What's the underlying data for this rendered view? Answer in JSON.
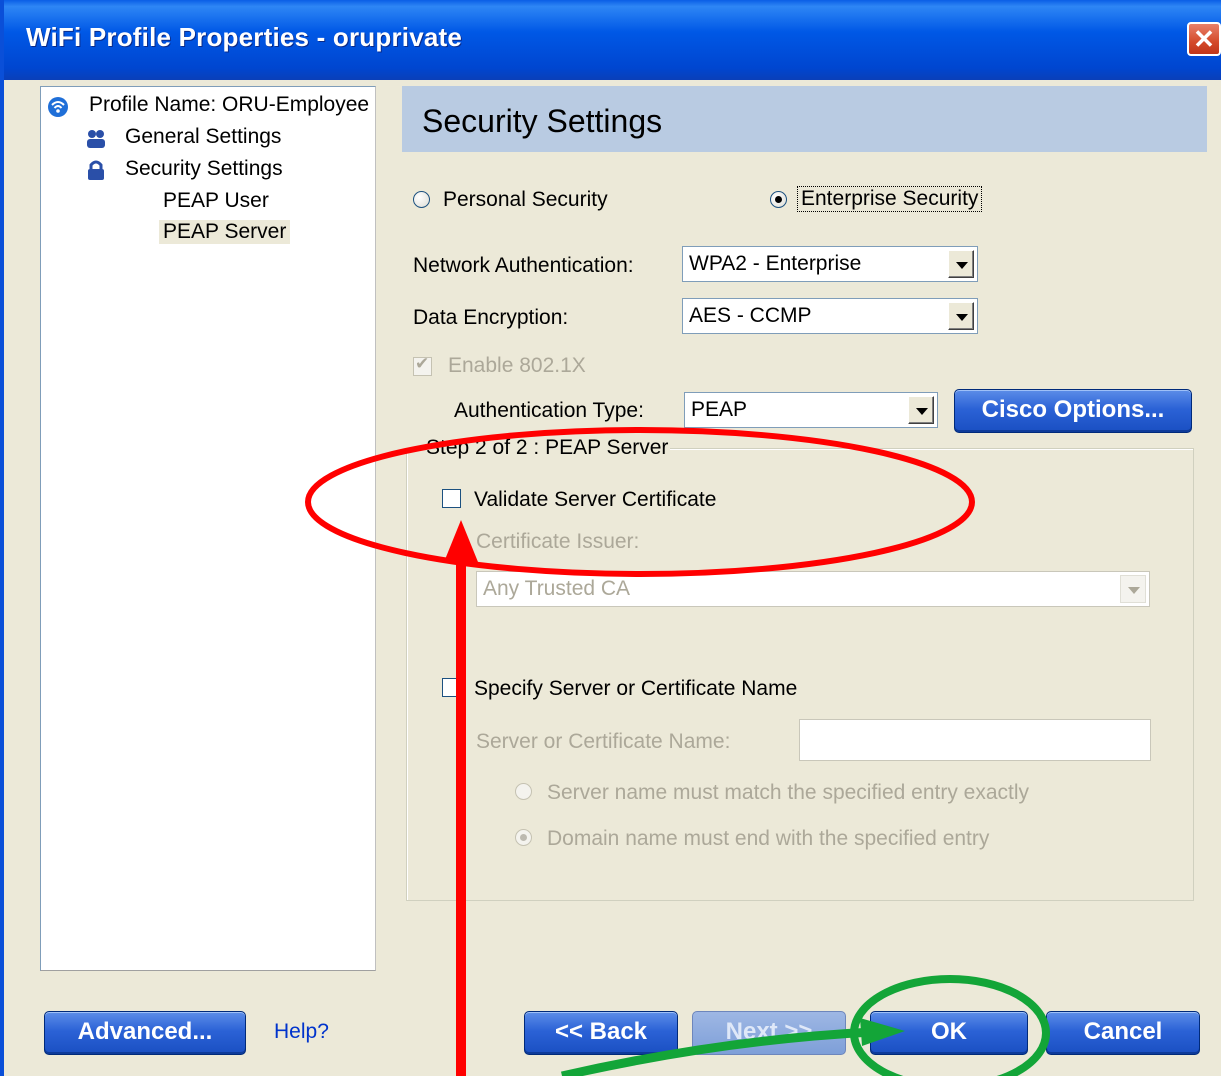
{
  "window": {
    "title": "WiFi Profile Properties - oruprivate",
    "close_glyph": "✕"
  },
  "tree": {
    "profile_name": "Profile Name: ORU-Employee",
    "general_settings": "General Settings",
    "security_settings": "Security Settings",
    "peap_user": "PEAP User",
    "peap_server": "PEAP Server"
  },
  "header": {
    "title": "Security Settings"
  },
  "security_mode": {
    "personal_label": "Personal Security",
    "enterprise_label": "Enterprise Security",
    "selected": "Enterprise Security"
  },
  "network_auth": {
    "label": "Network Authentication:",
    "value": "WPA2 - Enterprise"
  },
  "data_encryption": {
    "label": "Data Encryption:",
    "value": "AES - CCMP"
  },
  "enable_8021x": {
    "label": "Enable 802.1X",
    "checked": true,
    "enabled": false
  },
  "auth_type": {
    "label": "Authentication Type:",
    "value": "PEAP"
  },
  "cisco_options_label": "Cisco Options...",
  "group": {
    "title": "Step 2 of 2 : PEAP Server",
    "validate_cert": {
      "label": "Validate Server Certificate",
      "checked": false
    },
    "cert_issuer_label": "Certificate Issuer:",
    "cert_issuer_value": "Any Trusted CA",
    "specify_server": {
      "label": "Specify Server or Certificate Name",
      "checked": false
    },
    "server_name_label": "Server or Certificate Name:",
    "server_name_value": "",
    "match_exact": "Server name must match the specified entry exactly",
    "domain_end": "Domain name must end with the specified entry",
    "match_selected": "Domain name must end with the specified entry"
  },
  "footer": {
    "advanced": "Advanced...",
    "help": "Help?",
    "back": "<< Back",
    "next": "Next >>",
    "ok": "OK",
    "cancel": "Cancel"
  },
  "colors": {
    "annotation_red": "#ff0000",
    "annotation_green": "#13a538",
    "title_bar": "#0054e3",
    "header_band": "#b9cbe2"
  },
  "icons": {
    "profile": "wifi-icon",
    "general": "users-icon",
    "security": "lock-icon"
  }
}
